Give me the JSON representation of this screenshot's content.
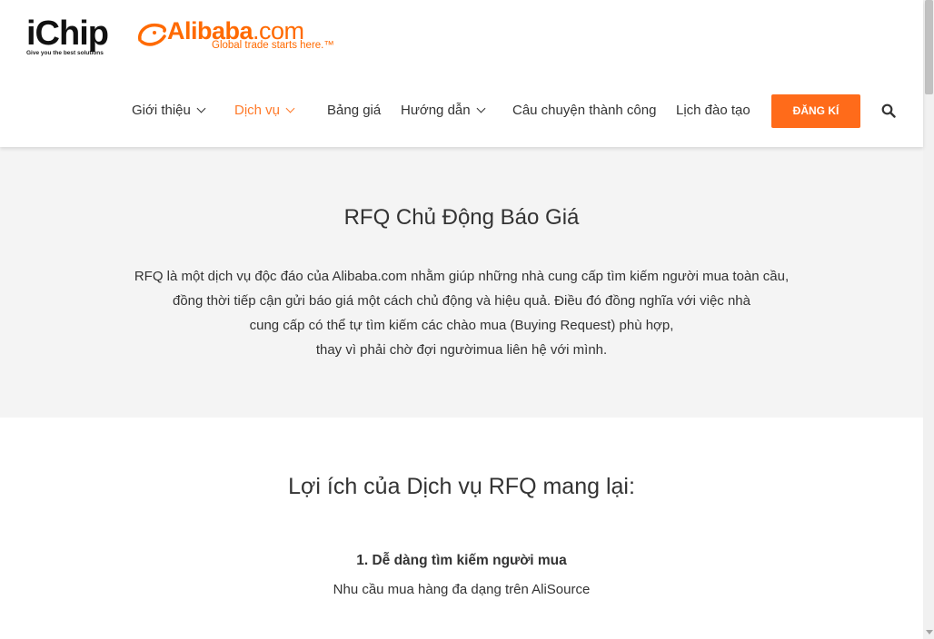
{
  "header": {
    "ichip_logo": {
      "text": "iChip",
      "tagline": "Give you the best solutions"
    },
    "alibaba_logo": {
      "brand": "Alibaba",
      "dotcom": ".com",
      "slogan": "Global trade starts here.™",
      "color": "#ff6a00"
    }
  },
  "nav": {
    "items": [
      {
        "label": "Giới thiệu",
        "has_dropdown": true
      },
      {
        "label": "Dịch vụ",
        "has_dropdown": true,
        "active": true
      },
      {
        "label": "Bảng giá",
        "has_dropdown": false
      },
      {
        "label": "Hướng dẫn",
        "has_dropdown": true
      },
      {
        "label": "Câu chuyện thành công",
        "has_dropdown": false
      },
      {
        "label": "Lịch đào tạo",
        "has_dropdown": false
      }
    ],
    "register_label": "ĐĂNG KÍ",
    "search_icon": "search-icon",
    "active_color": "#ff7a2a",
    "button_color": "#ff6b1a"
  },
  "hero": {
    "title": "RFQ Chủ Động Báo Giá",
    "paragraph_lines": [
      "RFQ là một dịch vụ độc đáo của Alibaba.com nhằm giúp những nhà cung cấp tìm kiếm người mua toàn cầu,",
      "đồng thời tiếp cận gửi báo giá một cách chủ động và hiệu quả. Điều đó đồng nghĩa với việc nhà",
      "cung cấp có thể tự tìm kiếm các chào mua (Buying Request) phù hợp,",
      "thay vì phải chờ đợi ngườimua liên hệ với mình."
    ]
  },
  "benefits": {
    "title": "Lợi ích của Dịch vụ RFQ mang lại:",
    "items": [
      {
        "heading": "1. Dễ dàng tìm kiếm người mua",
        "text": "Nhu cầu mua hàng đa dạng trên AliSource"
      }
    ]
  }
}
